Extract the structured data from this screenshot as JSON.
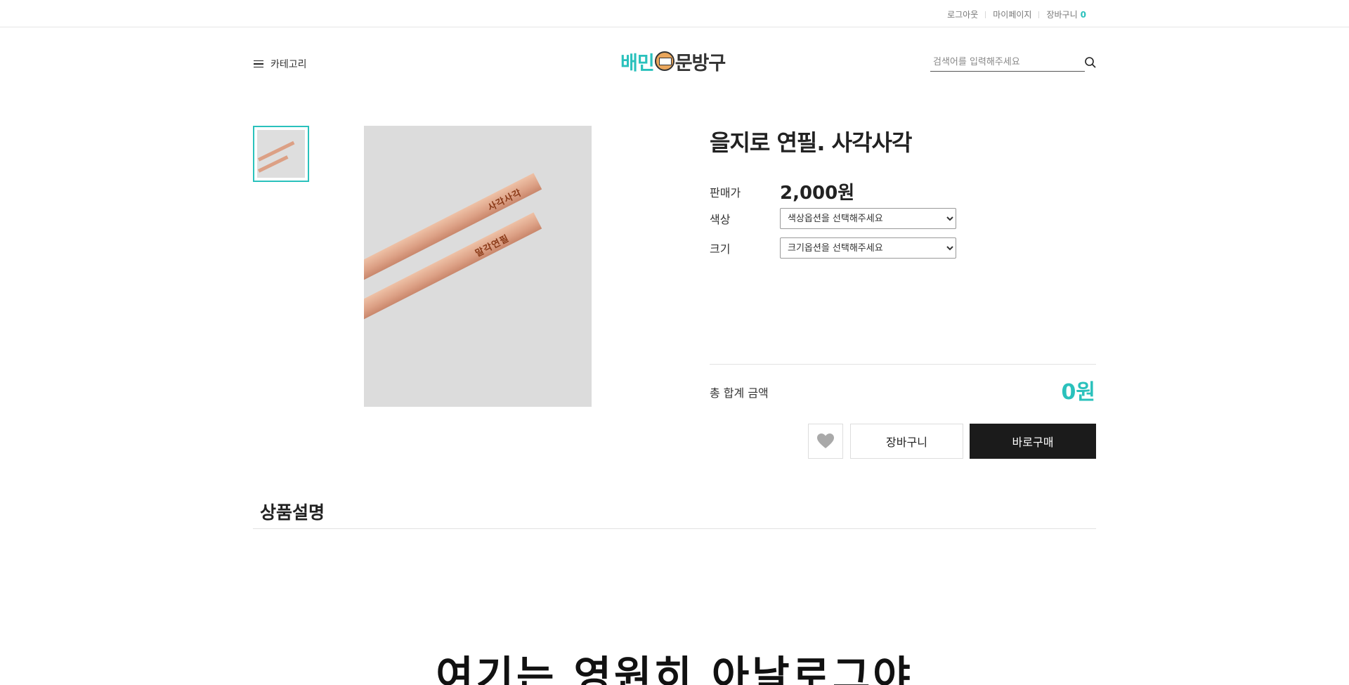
{
  "topbar": {
    "logout": "로그아웃",
    "mypage": "마이페이지",
    "cart_label": "장바구니",
    "cart_count": "0"
  },
  "header": {
    "category_label": "카테고리",
    "logo_text_1": "배민",
    "logo_text_2": "문방구",
    "search_placeholder": "검색어를 입력해주세요",
    "search_icon": "search-icon"
  },
  "product": {
    "title": "을지로 연필. 사각사각",
    "price_label": "판매가",
    "price": "2,000원",
    "color_label": "색상",
    "color_selected": "색상옵션을 선택해주세요",
    "size_label": "크기",
    "size_selected": "크기옵션을 선택해주세요",
    "total_label": "총 합계 금액",
    "total_value": "0원",
    "wish_icon": "heart-icon",
    "cart_button": "장바구니",
    "buy_button": "바로구매",
    "image_text_1": "사각사각",
    "image_text_2": "말각연필"
  },
  "description": {
    "title": "상품설명",
    "banner": "여기는 영원히 아날로그야"
  },
  "colors": {
    "accent": "#2ac1bc",
    "buy_button": "#1b1b1b"
  }
}
